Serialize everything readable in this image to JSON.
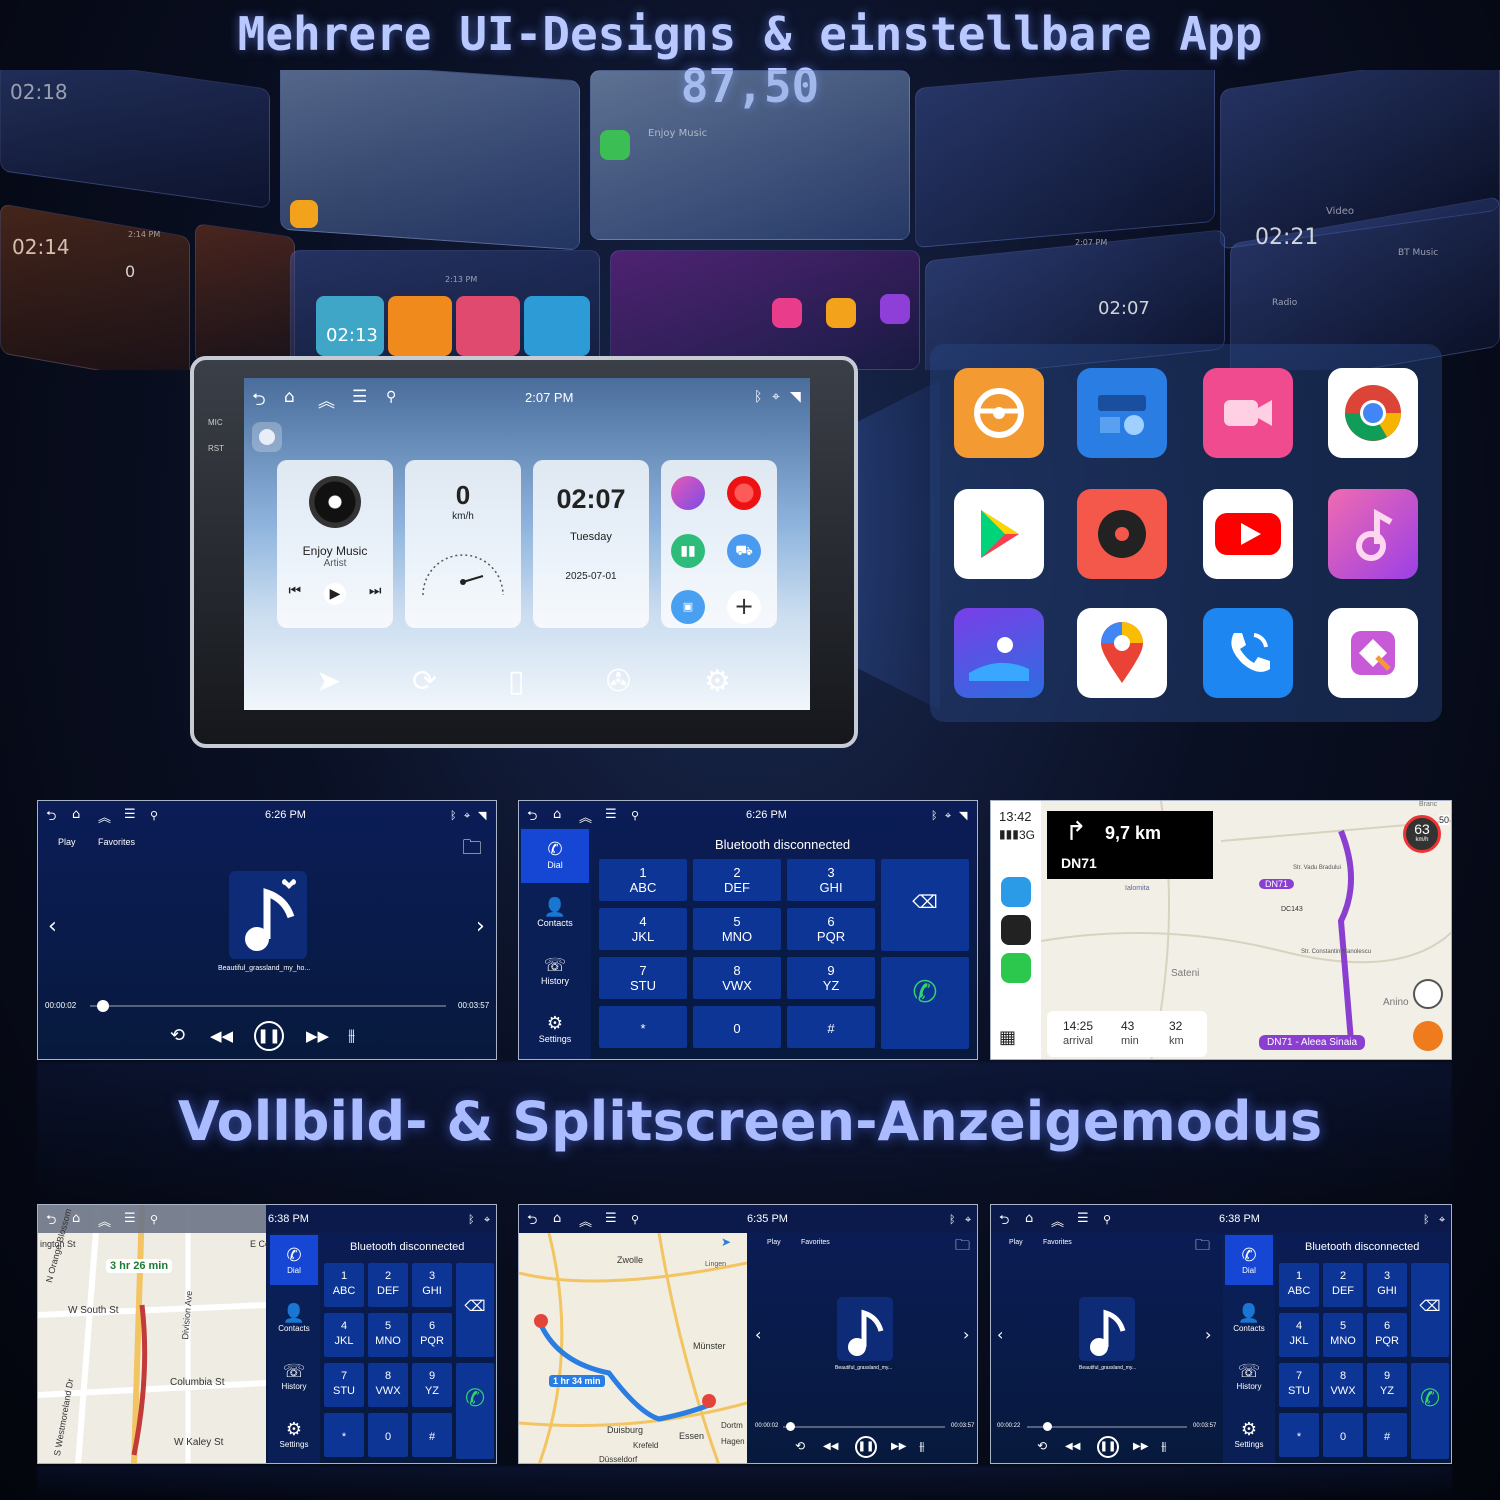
{
  "headline": {
    "line1": "Mehrere UI-Designs & einstellbare App",
    "line2": "87,50"
  },
  "subheadline": "Vollbild- & Splitscreen-Anzeigemodus",
  "collage": {
    "texts": [
      "02:18",
      "02:14",
      "02:13",
      "02:21",
      "02:07",
      "0",
      "Enjoy Music",
      "Video",
      "BT Music",
      "Radio",
      "2:13 PM",
      "2:14 PM",
      "2:07 PM"
    ]
  },
  "device": {
    "side_labels": [
      "MIC",
      "RST"
    ],
    "status": {
      "time": "2:07 PM"
    },
    "music_card": {
      "title": "Enjoy Music",
      "artist": "Artist"
    },
    "speed_card": {
      "value": "0",
      "unit": "km/h"
    },
    "clock_card": {
      "time": "02:07",
      "day": "Tuesday",
      "date": "2025-07-01"
    },
    "icons": {
      "back": "back-icon",
      "home": "home-icon",
      "apps": "chevron-up-icon",
      "menu": "menu-icon",
      "usb": "usb-icon",
      "bluetooth": "bluetooth-icon",
      "location": "location-icon",
      "wifi": "wifi-icon"
    }
  },
  "appgrid": {
    "apps": [
      {
        "name": "steering-wheel-app",
        "color": "#f39a32"
      },
      {
        "name": "radio-app",
        "color": "#2a7de2"
      },
      {
        "name": "video-app",
        "color": "#f04b8e"
      },
      {
        "name": "chrome-app",
        "color": "#ffffff"
      },
      {
        "name": "play-store-app",
        "color": "#ffffff"
      },
      {
        "name": "music-player-app",
        "color": "#f4584b"
      },
      {
        "name": "youtube-app",
        "color": "#ffffff"
      },
      {
        "name": "bt-music-app",
        "color": "#d14bd8"
      },
      {
        "name": "gallery-app",
        "color": "#5a53e8"
      },
      {
        "name": "google-maps-app",
        "color": "#ffffff"
      },
      {
        "name": "phone-app",
        "color": "#1e86f0"
      },
      {
        "name": "screen-mirror-app",
        "color": "#ffffff"
      }
    ]
  },
  "music_screen": {
    "time": "6:26 PM",
    "tabs": [
      "Play",
      "Favorites"
    ],
    "track": "Beautiful_grassland_my_ho...",
    "elapsed": "00:00:02",
    "total": "00:03:57",
    "progress": 0.02
  },
  "phone_screen": {
    "time": "6:26 PM",
    "status": "Bluetooth disconnected",
    "side": [
      "Dial",
      "Contacts",
      "History",
      "Settings"
    ],
    "keys": [
      {
        "d": "1",
        "l": "ABC"
      },
      {
        "d": "2",
        "l": "DEF"
      },
      {
        "d": "3",
        "l": "GHI"
      },
      {
        "d": "4",
        "l": "JKL"
      },
      {
        "d": "5",
        "l": "MNO"
      },
      {
        "d": "6",
        "l": "PQR"
      },
      {
        "d": "7",
        "l": "STU"
      },
      {
        "d": "8",
        "l": "VWX"
      },
      {
        "d": "9",
        "l": "YZ"
      },
      {
        "d": "*",
        "l": ""
      },
      {
        "d": "0",
        "l": ""
      },
      {
        "d": "#",
        "l": ""
      }
    ]
  },
  "nav_screen": {
    "clock": "13:42",
    "network": "3G",
    "distance": "9,7 km",
    "road": "DN71",
    "speed_limit": "63",
    "speed_unit": "km/h",
    "limit_small": "50",
    "eta": "14:25",
    "eta_label": "arrival",
    "duration": "43",
    "duration_label": "min",
    "remaining": "32",
    "remaining_label": "km",
    "destination": "DN71 - Aleea Sinaia",
    "places": [
      "Sateni",
      "Anino",
      "DC143",
      "DN71",
      "Str. Vadu Bradului",
      "Str. Constantin Manolescu",
      "Ialomita",
      "Branc"
    ]
  },
  "split1": {
    "time": "6:38 PM",
    "eta": "3 hr 26 min",
    "streets": [
      "ington St",
      "W South St",
      "Columbia St",
      "W Kaley St",
      "N Orange Blossom",
      "S Westmoreland Dr",
      "Division Ave",
      "E Co"
    ],
    "status": "Bluetooth disconnected"
  },
  "split2": {
    "time": "6:35 PM",
    "eta": "1 hr 34 min",
    "cities": [
      "Zwolle",
      "Münster",
      "Duisburg",
      "Essen",
      "Krefeld",
      "Dortm",
      "Hagen",
      "Lingen",
      "Düsseldorf"
    ],
    "tabs": [
      "Play",
      "Favorites"
    ],
    "track": "Beautiful_grassland_my...",
    "elapsed": "00:00:02",
    "total": "00:03:57",
    "progress": 0.02
  },
  "split3": {
    "time": "6:38 PM",
    "tabs": [
      "Play",
      "Favorites"
    ],
    "track": "Beautiful_grassland_my...",
    "elapsed": "00:00:22",
    "total": "00:03:57",
    "progress": 0.1,
    "status": "Bluetooth disconnected"
  }
}
